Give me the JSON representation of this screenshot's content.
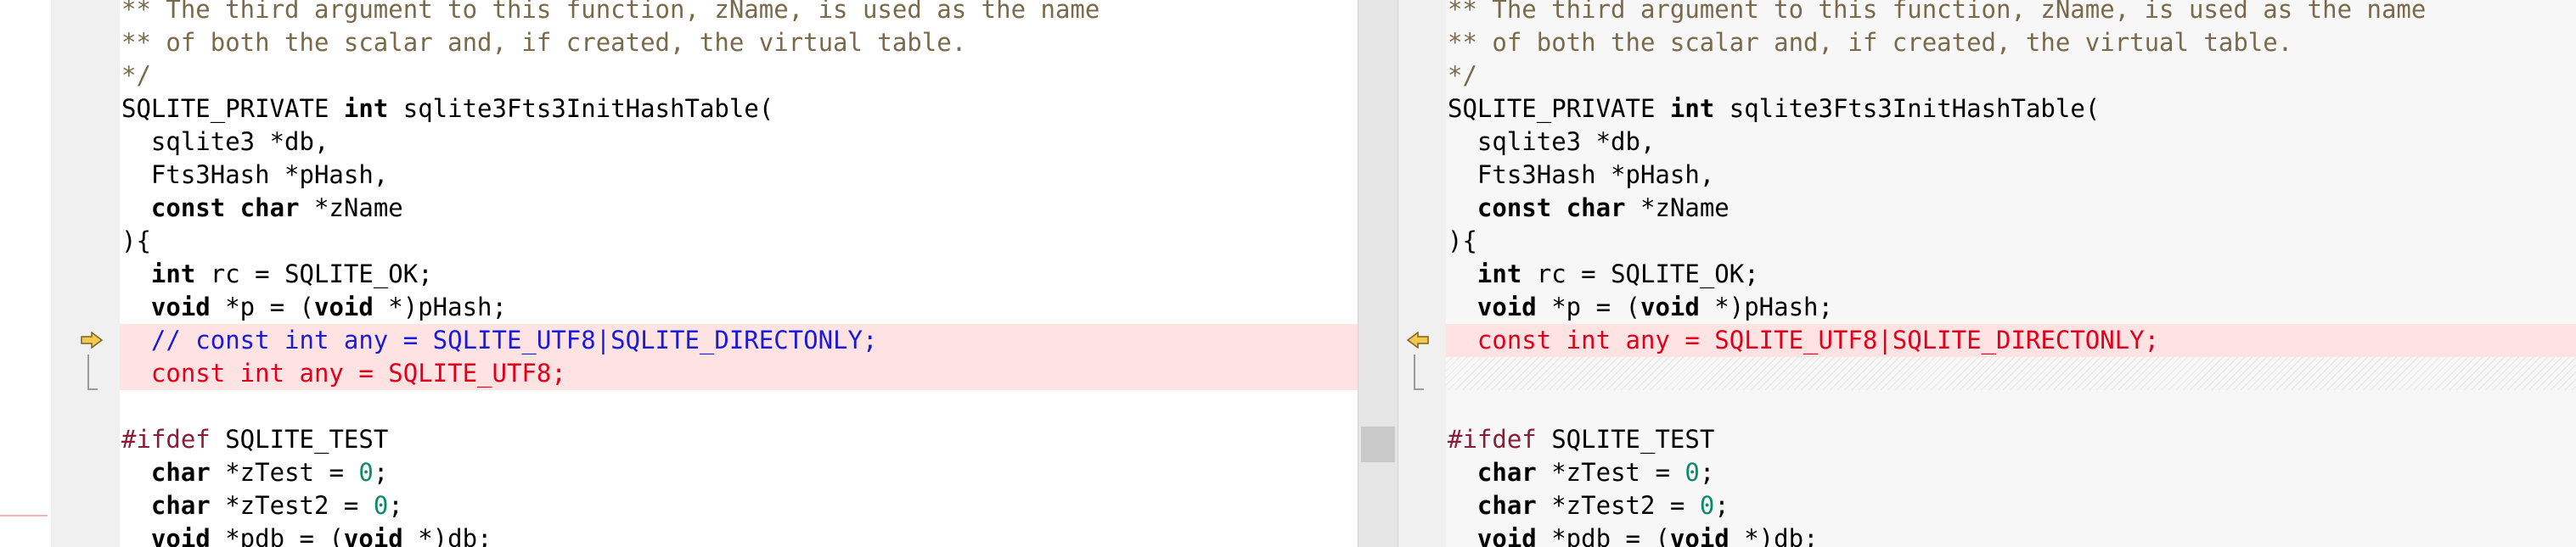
{
  "colors": {
    "deleted_bg": "#ffe3e3",
    "comment": "#7a6a4a",
    "removed_text": "#e0001b",
    "commented_out_text": "#1a1adc",
    "number": "#0c8a6a",
    "preprocessor": "#8a1c3a",
    "arrow_fill": "#f2c94c"
  },
  "icons": {
    "left_arrow": "right-arrow-icon",
    "right_arrow": "left-arrow-icon"
  },
  "left": {
    "lines": [
      [
        "** The third argument to this function, zName, is used as the name"
      ],
      [
        "** of both the scalar and, if created, the virtual table."
      ],
      [
        "*/"
      ],
      [
        "SQLITE_PRIVATE ",
        "int",
        " sqlite3Fts3InitHashTable("
      ],
      [
        "  sqlite3 *db,"
      ],
      [
        "  Fts3Hash *pHash,"
      ],
      [
        "  ",
        "const",
        " ",
        "char",
        " *zName"
      ],
      [
        "){"
      ],
      [
        "  ",
        "int",
        " rc = SQLITE_OK;"
      ],
      [
        "  ",
        "void",
        " *p = (",
        "void",
        " *)pHash;"
      ],
      [
        "  // const int any = SQLITE_UTF8|SQLITE_DIRECTONLY;"
      ],
      [
        "  const int any = SQLITE_UTF8;"
      ],
      [
        ""
      ],
      [
        "#ifdef",
        " SQLITE_TEST"
      ],
      [
        "  ",
        "char",
        " *zTest = ",
        "0",
        ";"
      ],
      [
        "  ",
        "char",
        " *zTest2 = ",
        "0",
        ";"
      ],
      [
        "  ",
        "void",
        " *pdb = (",
        "void",
        " *)db;"
      ]
    ]
  },
  "right": {
    "lines": [
      [
        "** The third argument to this function, zName, is used as the name"
      ],
      [
        "** of both the scalar and, if created, the virtual table."
      ],
      [
        "*/"
      ],
      [
        "SQLITE_PRIVATE ",
        "int",
        " sqlite3Fts3InitHashTable("
      ],
      [
        "  sqlite3 *db,"
      ],
      [
        "  Fts3Hash *pHash,"
      ],
      [
        "  ",
        "const",
        " ",
        "char",
        " *zName"
      ],
      [
        "){"
      ],
      [
        "  ",
        "int",
        " rc = SQLITE_OK;"
      ],
      [
        "  ",
        "void",
        " *p = (",
        "void",
        " *)pHash;"
      ],
      [
        "  const int any = SQLITE_UTF8|SQLITE_DIRECTONLY;"
      ],
      [
        ""
      ],
      [
        ""
      ],
      [
        "#ifdef",
        " SQLITE_TEST"
      ],
      [
        "  ",
        "char",
        " *zTest = ",
        "0",
        ";"
      ],
      [
        "  ",
        "char",
        " *zTest2 = ",
        "0",
        ";"
      ],
      [
        "  ",
        "void",
        " *pdb = (",
        "void",
        " *)db;"
      ]
    ]
  }
}
